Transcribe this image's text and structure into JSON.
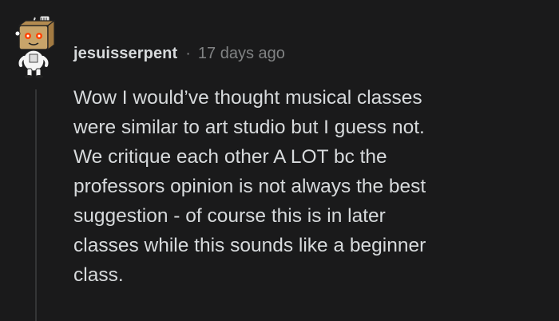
{
  "comment": {
    "author": "jesuisserpent",
    "separator": "·",
    "timestamp": "17 days ago",
    "avatar_icon": "snoo-avatar-icon",
    "body_lines": [
      "Wow I would’ve thought musical classes",
      "were similar to art studio but I guess not.",
      "We critique each other A LOT bc the",
      "professors opinion is not always the best",
      "suggestion - of course this is in later",
      "classes while this sounds like a beginner",
      "class."
    ]
  },
  "colors": {
    "background": "#1a1a1b",
    "text": "#d7dadc",
    "muted": "#818384",
    "thread_line": "#343536"
  }
}
